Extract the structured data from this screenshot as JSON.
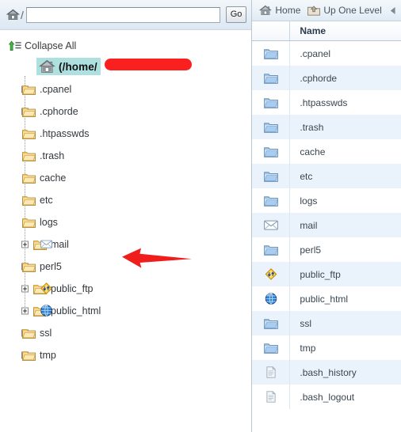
{
  "left_panel": {
    "path_bar": {
      "home_icon": "home-icon",
      "separator": "/",
      "input_value": "",
      "input_placeholder": "",
      "go_label": "Go"
    },
    "collapse_all": {
      "icon": "collapse-all-icon",
      "label": "Collapse All"
    },
    "root": {
      "icon": "home-icon",
      "label": "(/home/",
      "redacted": true,
      "selected": true
    },
    "tree_items": [
      {
        "label": ".cpanel",
        "icon": "folder-icon",
        "overlay": null,
        "expandable": true
      },
      {
        "label": ".cphorde",
        "icon": "folder-icon",
        "overlay": null,
        "expandable": true
      },
      {
        "label": ".htpasswds",
        "icon": "folder-icon",
        "overlay": null,
        "expandable": false
      },
      {
        "label": ".trash",
        "icon": "folder-icon",
        "overlay": null,
        "expandable": false
      },
      {
        "label": "cache",
        "icon": "folder-icon",
        "overlay": null,
        "expandable": false
      },
      {
        "label": "etc",
        "icon": "folder-icon",
        "overlay": null,
        "expandable": false
      },
      {
        "label": "logs",
        "icon": "folder-icon",
        "overlay": null,
        "expandable": false
      },
      {
        "label": "mail",
        "icon": "folder-icon",
        "overlay": "envelope-icon",
        "expandable": true
      },
      {
        "label": "perl5",
        "icon": "folder-icon",
        "overlay": null,
        "expandable": true
      },
      {
        "label": "public_ftp",
        "icon": "folder-icon",
        "overlay": "ftp-icon",
        "expandable": true
      },
      {
        "label": "public_html",
        "icon": "folder-icon",
        "overlay": "globe-icon",
        "expandable": true
      },
      {
        "label": "ssl",
        "icon": "folder-icon",
        "overlay": null,
        "expandable": true
      },
      {
        "label": "tmp",
        "icon": "folder-icon",
        "overlay": null,
        "expandable": true
      }
    ],
    "annotation": {
      "arrow_color": "#f01d1d",
      "points_at": "public_html",
      "redaction_color": "#fb2020"
    }
  },
  "right_panel": {
    "toolbar": {
      "home_label": "Home",
      "home_icon": "home-icon",
      "up_one_level_label": "Up One Level",
      "up_one_level_icon": "folder-up-icon",
      "back_icon": "back-arrow-icon"
    },
    "columns": [
      "",
      "Name"
    ],
    "rows": [
      {
        "name": ".cpanel",
        "icon": "folder-icon"
      },
      {
        "name": ".cphorde",
        "icon": "folder-icon"
      },
      {
        "name": ".htpasswds",
        "icon": "folder-icon"
      },
      {
        "name": ".trash",
        "icon": "folder-icon"
      },
      {
        "name": "cache",
        "icon": "folder-icon"
      },
      {
        "name": "etc",
        "icon": "folder-icon"
      },
      {
        "name": "logs",
        "icon": "folder-icon"
      },
      {
        "name": "mail",
        "icon": "envelope-icon"
      },
      {
        "name": "perl5",
        "icon": "folder-icon"
      },
      {
        "name": "public_ftp",
        "icon": "ftp-icon"
      },
      {
        "name": "public_html",
        "icon": "globe-icon"
      },
      {
        "name": "ssl",
        "icon": "folder-icon"
      },
      {
        "name": "tmp",
        "icon": "folder-icon"
      },
      {
        "name": ".bash_history",
        "icon": "file-icon"
      },
      {
        "name": ".bash_logout",
        "icon": "file-icon"
      }
    ]
  },
  "colors": {
    "selection": "#aee0e0",
    "alt_row": "#eaf3fb",
    "toolbar_bg": "#e9f1f8",
    "annotation_red": "#f01d1d",
    "folder_yellow": "#f3c košice"
  }
}
